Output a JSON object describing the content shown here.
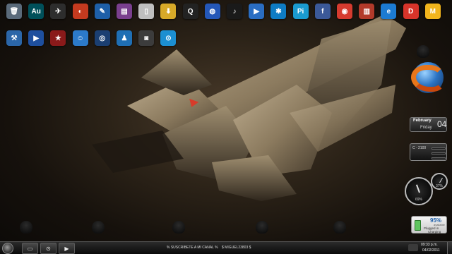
{
  "desktop": {
    "row1_icons": [
      {
        "name": "recycle-bin-icon",
        "glyph": "🗑",
        "color": "#5a6a7a"
      },
      {
        "name": "adobe-audition-icon",
        "glyph": "Au",
        "color": "#00505a"
      },
      {
        "name": "gun-shortcut-icon",
        "glyph": "✈",
        "color": "#2d2d2d"
      },
      {
        "name": "ccleaner-icon",
        "glyph": "◐",
        "color": "#c43a1f"
      },
      {
        "name": "editor-shortcut-icon",
        "glyph": "✎",
        "color": "#1e5fa8"
      },
      {
        "name": "winrar-icon",
        "glyph": "▤",
        "color": "#7a3f8e"
      },
      {
        "name": "blank-document-icon",
        "glyph": "▯",
        "color": "#bfbfbf"
      },
      {
        "name": "folder-shortcut-icon",
        "glyph": "⬇",
        "color": "#d7a928"
      },
      {
        "name": "quake-icon",
        "glyph": "Q",
        "color": "#222222"
      },
      {
        "name": "network-globe-icon",
        "glyph": "◍",
        "color": "#2457b8"
      },
      {
        "name": "music-player-icon",
        "glyph": "♪",
        "color": "#1a1a1a"
      },
      {
        "name": "media-blue-icon",
        "glyph": "▶",
        "color": "#2a6dc2"
      },
      {
        "name": "photoshop-icon",
        "glyph": "✱",
        "color": "#0e7cc4"
      },
      {
        "name": "pinnacle-icon",
        "glyph": "Pi",
        "color": "#1a9bd0"
      },
      {
        "name": "facebook-icon",
        "glyph": "f",
        "color": "#3b5998"
      },
      {
        "name": "google-chrome-icon",
        "glyph": "◉",
        "color": "#d63b2f"
      },
      {
        "name": "books-icon",
        "glyph": "▥",
        "color": "#b23a2a"
      },
      {
        "name": "internet-explorer-icon",
        "glyph": "e",
        "color": "#1c7bd2"
      },
      {
        "name": "daemon-tools-icon",
        "glyph": "D",
        "color": "#d8342a"
      },
      {
        "name": "media-monkey-icon",
        "glyph": "M",
        "color": "#f2b51c"
      }
    ],
    "row2_icons": [
      {
        "name": "tools-shortcut-icon",
        "glyph": "⚒",
        "color": "#2b66a8"
      },
      {
        "name": "media-play-icon",
        "glyph": "▶",
        "color": "#1e4f9e"
      },
      {
        "name": "star-shortcut-icon",
        "glyph": "★",
        "color": "#8a1a1a"
      },
      {
        "name": "user-account-icon",
        "glyph": "☺",
        "color": "#2c7ac9"
      },
      {
        "name": "disc-burner-icon",
        "glyph": "◎",
        "color": "#1b3f72"
      },
      {
        "name": "messenger-icon",
        "glyph": "♟",
        "color": "#1f6fb4"
      },
      {
        "name": "webcam-icon",
        "glyph": "◙",
        "color": "#3c3c3c"
      },
      {
        "name": "office-app-icon",
        "glyph": "⊙",
        "color": "#1c8fd1"
      }
    ]
  },
  "gadgets": {
    "calendar": {
      "month": "February",
      "weekday": "Friday",
      "day": "04"
    },
    "cpu_meter": {
      "label": "C - 2100"
    },
    "gauges": {
      "cpu_percent": "69%",
      "ram_percent": "37%"
    },
    "battery": {
      "percent": "95%",
      "available_label": "available",
      "state_line1": "Plugged in",
      "state_line2": "Charging",
      "level": 0.95
    }
  },
  "taskbar": {
    "buttons": [
      {
        "name": "taskbar-folder-button",
        "glyph": "▭"
      },
      {
        "name": "taskbar-office-button",
        "glyph": "⊙"
      },
      {
        "name": "taskbar-media-button",
        "glyph": "▶"
      }
    ],
    "running_items": [
      "% SUSCRIBETE A MI CANAL %",
      "$ MIGUEL23803 $"
    ],
    "clock": {
      "time": "09:33 p.m.",
      "date": "04/02/2011"
    }
  }
}
